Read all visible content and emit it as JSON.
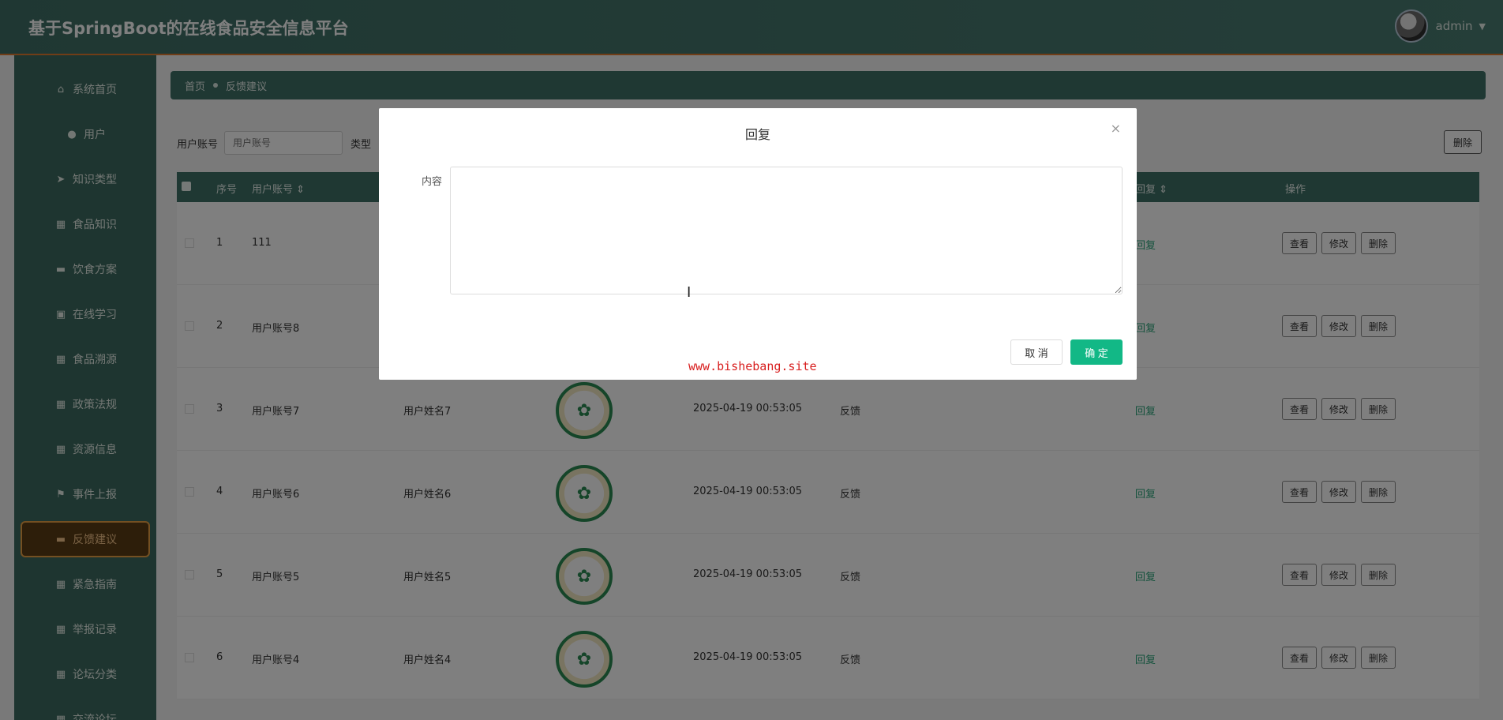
{
  "header": {
    "title": "基于SpringBoot的在线食品安全信息平台",
    "username": "admin"
  },
  "sidebar": {
    "items": [
      {
        "label": "系统首页",
        "icon": "home-icon",
        "glyph": "⌂"
      },
      {
        "label": "用户",
        "icon": "user-icon",
        "glyph": "●"
      },
      {
        "label": "知识类型",
        "icon": "send-icon",
        "glyph": "➤"
      },
      {
        "label": "食品知识",
        "icon": "grid-icon",
        "glyph": "▦"
      },
      {
        "label": "饮食方案",
        "icon": "monitor-icon",
        "glyph": "▬"
      },
      {
        "label": "在线学习",
        "icon": "briefcase-icon",
        "glyph": "▣"
      },
      {
        "label": "食品溯源",
        "icon": "grid-icon",
        "glyph": "▦"
      },
      {
        "label": "政策法规",
        "icon": "grid-icon",
        "glyph": "▦"
      },
      {
        "label": "资源信息",
        "icon": "grid-icon",
        "glyph": "▦"
      },
      {
        "label": "事件上报",
        "icon": "flag-icon",
        "glyph": "⚑"
      },
      {
        "label": "反馈建议",
        "icon": "ticket-icon",
        "glyph": "▬",
        "active": true
      },
      {
        "label": "紧急指南",
        "icon": "grid-icon",
        "glyph": "▦"
      },
      {
        "label": "举报记录",
        "icon": "grid-icon",
        "glyph": "▦"
      },
      {
        "label": "论坛分类",
        "icon": "grid-icon",
        "glyph": "▦"
      },
      {
        "label": "交流论坛",
        "icon": "grid-icon",
        "glyph": "▦"
      }
    ]
  },
  "breadcrumb": {
    "home": "首页",
    "current": "反馈建议"
  },
  "search": {
    "label": "用户账号",
    "placeholder": "用户账号",
    "type_label": "类型"
  },
  "toolbar": {
    "delete_label": "删除"
  },
  "table": {
    "headers": {
      "select": "",
      "index": "序号",
      "account": "用户账号 ⇕",
      "reply": "回复 ⇕",
      "ops": "操作"
    },
    "rows": [
      {
        "index": "1",
        "account": "111",
        "name": "",
        "time": "",
        "type": "",
        "reply": "回复"
      },
      {
        "index": "2",
        "account": "用户账号8",
        "name": "",
        "time": "",
        "type": "",
        "reply": "回复"
      },
      {
        "index": "3",
        "account": "用户账号7",
        "name": "用户姓名7",
        "time": "2025-04-19 00:53:05",
        "type": "反馈",
        "reply": "回复"
      },
      {
        "index": "4",
        "account": "用户账号6",
        "name": "用户姓名6",
        "time": "2025-04-19 00:53:05",
        "type": "反馈",
        "reply": "回复"
      },
      {
        "index": "5",
        "account": "用户账号5",
        "name": "用户姓名5",
        "time": "2025-04-19 00:53:05",
        "type": "反馈",
        "reply": "回复"
      },
      {
        "index": "6",
        "account": "用户账号4",
        "name": "用户姓名4",
        "time": "2025-04-19 00:53:05",
        "type": "反馈",
        "reply": "回复"
      }
    ],
    "ops": {
      "view": "查看",
      "edit": "修改",
      "delete": "删除"
    }
  },
  "dialog": {
    "title": "回复",
    "close": "×",
    "content_label": "内容",
    "content_value": "",
    "cancel_label": "取 消",
    "ok_label": "确 定",
    "watermark": "www.bishebang.site"
  }
}
